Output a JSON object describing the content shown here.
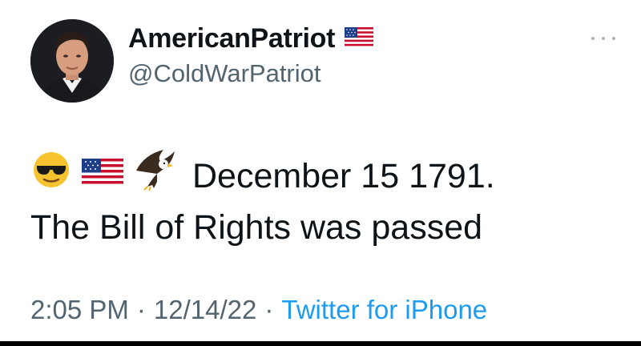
{
  "tweet": {
    "display_name": "AmericanPatriot",
    "handle": "@ColdWarPatriot",
    "line1": "December 15 1791.",
    "line2": "The Bill of Rights was passed",
    "time": "2:05 PM",
    "date": "12/14/22",
    "source": "Twitter for iPhone",
    "separator": "·",
    "emoji_icons": [
      "sunglasses-face-icon",
      "us-flag-icon",
      "eagle-icon"
    ]
  },
  "colors": {
    "text_primary": "#0f1419",
    "text_secondary": "#536471",
    "link": "#1d9bf0"
  }
}
